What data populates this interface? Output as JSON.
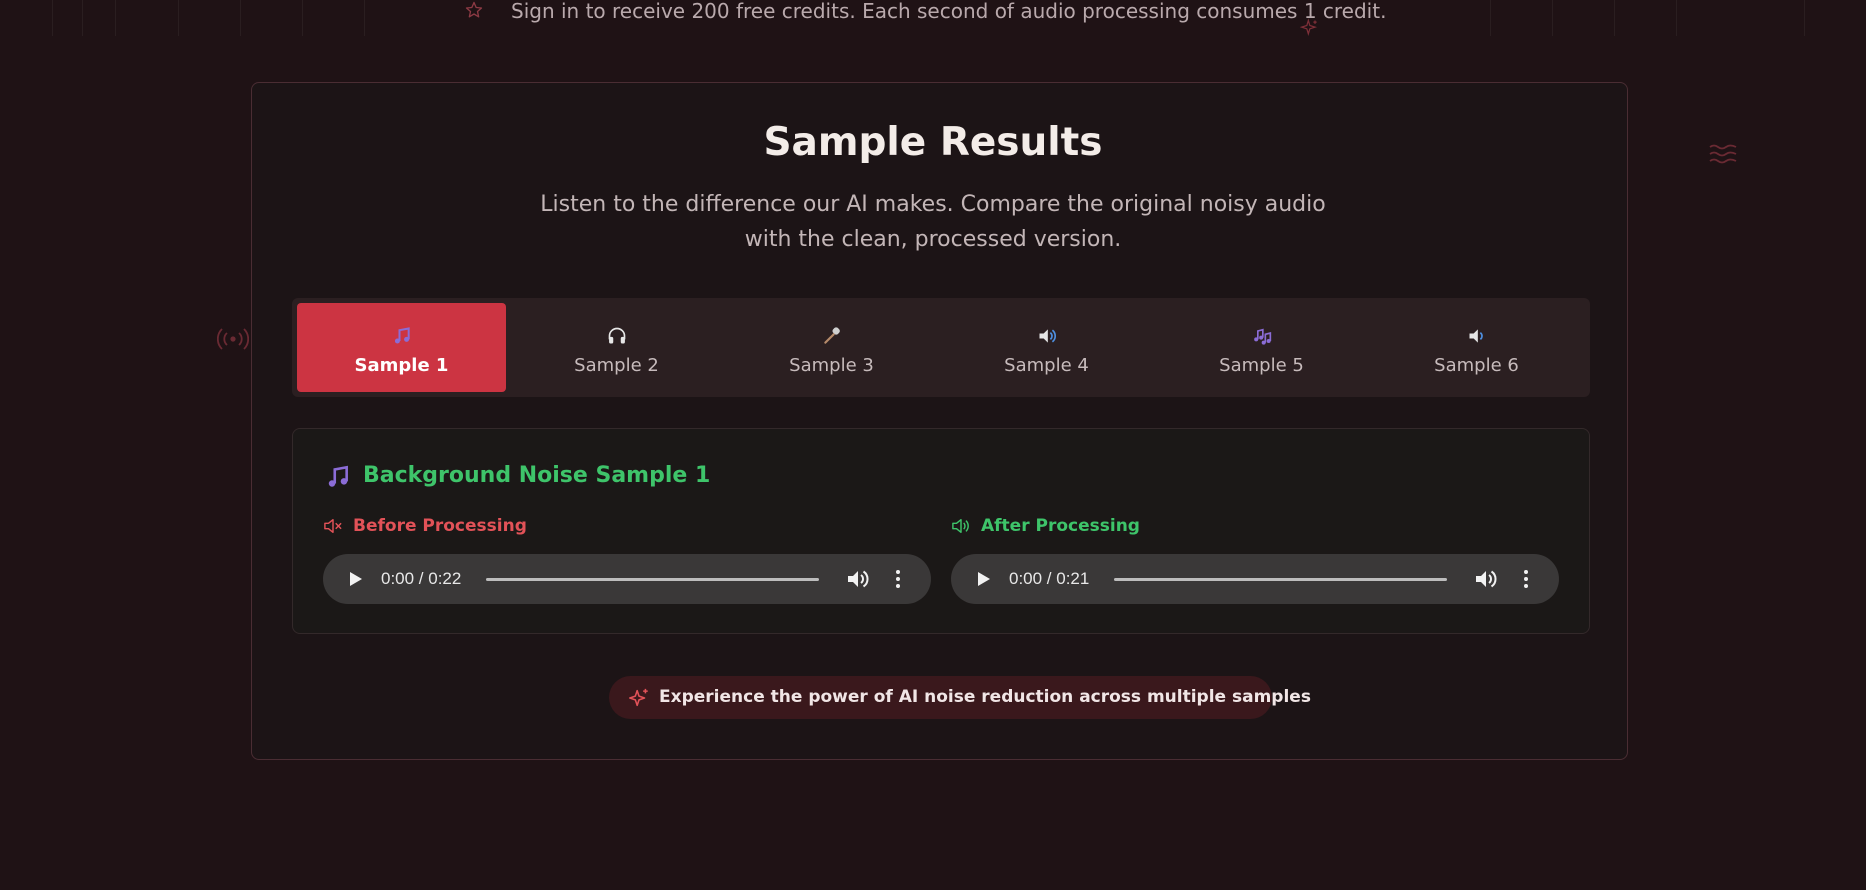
{
  "banner": {
    "text": "Sign in to receive 200 free credits. Each second of audio processing consumes 1 credit.",
    "icon": "star-icon"
  },
  "section": {
    "title": "Sample Results",
    "subtitle_line1": "Listen to the difference our AI makes. Compare the original noisy audio",
    "subtitle_line2": "with the clean, processed version."
  },
  "tabs": [
    {
      "label": "Sample 1",
      "icon": "music-note-icon",
      "active": true
    },
    {
      "label": "Sample 2",
      "icon": "headphones-icon",
      "active": false
    },
    {
      "label": "Sample 3",
      "icon": "microphone-icon",
      "active": false
    },
    {
      "label": "Sample 4",
      "icon": "speaker-icon",
      "active": false
    },
    {
      "label": "Sample 5",
      "icon": "music-notes-icon",
      "active": false
    },
    {
      "label": "Sample 6",
      "icon": "speaker-icon",
      "active": false
    }
  ],
  "panel": {
    "title": "Background Noise Sample 1",
    "before": {
      "label": "Before Processing",
      "time": "0:00 / 0:22"
    },
    "after": {
      "label": "After Processing",
      "time": "0:00 / 0:21"
    }
  },
  "footer": {
    "text": "Experience the power of AI noise reduction across multiple samples"
  },
  "colors": {
    "background": "#1f1215",
    "accent_red": "#cc3442",
    "success_green": "#3ec46a",
    "danger_red": "#e25258"
  }
}
